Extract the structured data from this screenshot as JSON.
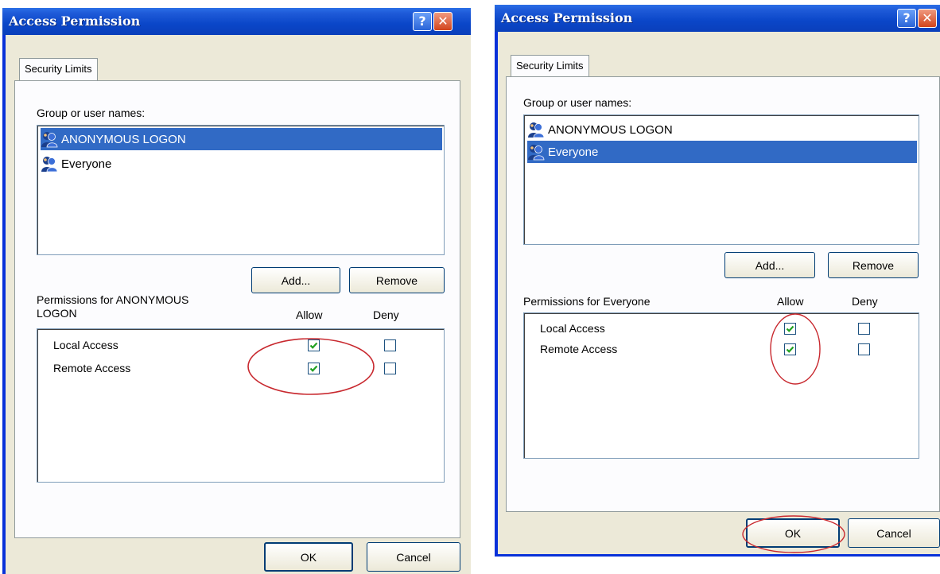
{
  "dialogs": [
    {
      "title": "Access Permission",
      "help_glyph": "?",
      "close_glyph": "✕",
      "tab_label": "Security Limits",
      "group_label": "Group or user names:",
      "users": [
        {
          "name": "ANONYMOUS LOGON",
          "selected": true
        },
        {
          "name": "Everyone",
          "selected": false
        }
      ],
      "add_label": "Add...",
      "remove_label": "Remove",
      "permissions_label": "Permissions for ANONYMOUS LOGON",
      "permissions_label_line1": "Permissions for ANONYMOUS",
      "permissions_label_line2": "LOGON",
      "allow_header": "Allow",
      "deny_header": "Deny",
      "permissions": [
        {
          "name": "Local Access",
          "allow": true,
          "deny": false
        },
        {
          "name": "Remote Access",
          "allow": true,
          "deny": false
        }
      ],
      "ok_label": "OK",
      "cancel_label": "Cancel"
    },
    {
      "title": "Access Permission",
      "help_glyph": "?",
      "close_glyph": "✕",
      "tab_label": "Security Limits",
      "group_label": "Group or user names:",
      "users": [
        {
          "name": "ANONYMOUS LOGON",
          "selected": false
        },
        {
          "name": "Everyone",
          "selected": true
        }
      ],
      "add_label": "Add...",
      "remove_label": "Remove",
      "permissions_label": "Permissions for Everyone",
      "allow_header": "Allow",
      "deny_header": "Deny",
      "permissions": [
        {
          "name": "Local Access",
          "allow": true,
          "deny": false
        },
        {
          "name": "Remote Access",
          "allow": true,
          "deny": false
        }
      ],
      "ok_label": "OK",
      "cancel_label": "Cancel"
    }
  ],
  "colors": {
    "titlebar": "#0a46c8",
    "dialog_face": "#ece9d8",
    "selection": "#316ac5",
    "check_green": "#21a121",
    "annotation_red": "#c8282e"
  },
  "icons": [
    "user-group-icon",
    "help-icon",
    "close-icon",
    "checkmark-icon"
  ]
}
